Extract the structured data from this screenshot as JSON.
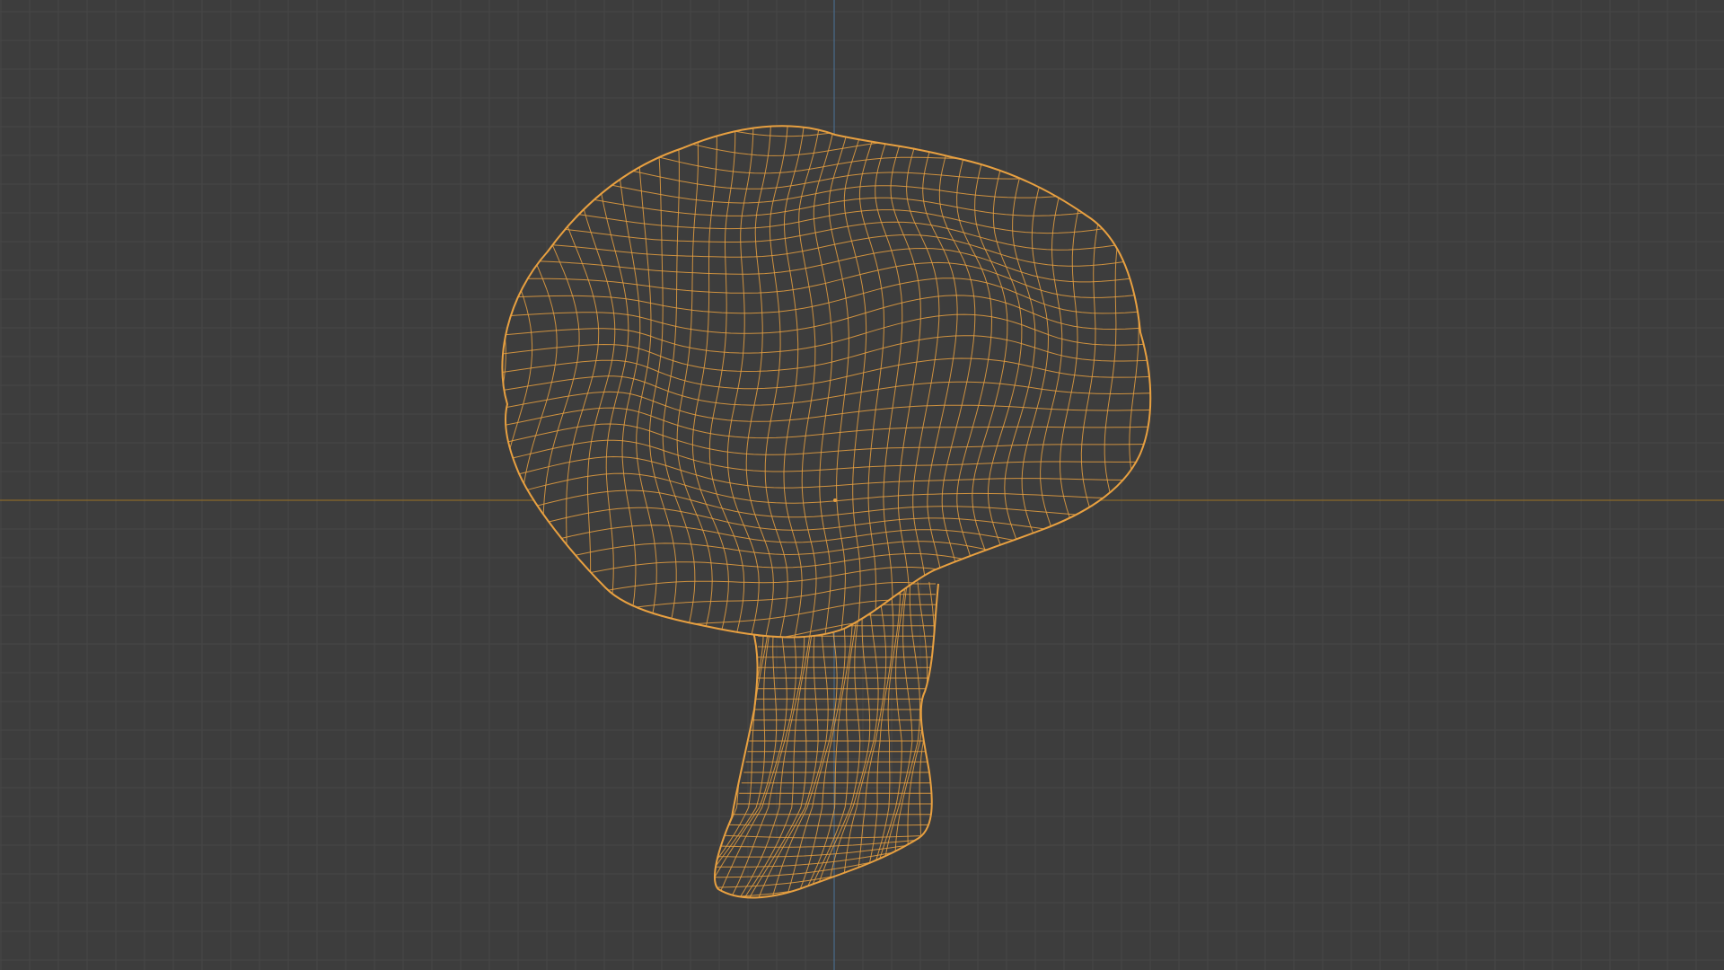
{
  "viewport": {
    "background": "#3d3d3d",
    "grid_minor_color": "#474747",
    "grid_major_color": "#4a4a4a",
    "x_axis_color": "#8a6a2a",
    "y_axis_color": "#4a6a8a",
    "wire_color": "#e8a040",
    "object_shape": "mushroom-mesh",
    "display_mode": "wireframe",
    "selected": true
  }
}
